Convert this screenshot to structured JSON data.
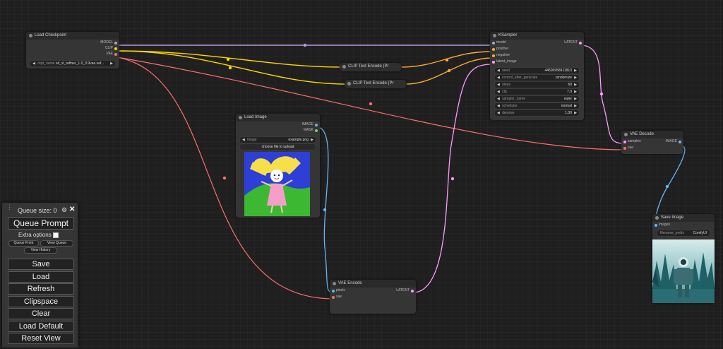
{
  "nodes": {
    "load_checkpoint": {
      "title": "Load Checkpoint",
      "outputs": [
        "MODEL",
        "CLIP",
        "VAE"
      ],
      "widget": {
        "label": "ckpt_name",
        "value": "sd_xl_refiner_1.0_0.9vae.saf..."
      }
    },
    "clip_text_encode_1": {
      "title": "CLIP Text Encode (Pr"
    },
    "clip_text_encode_2": {
      "title": "CLIP Text Encode (Pr"
    },
    "ksampler": {
      "title": "KSampler",
      "inputs": [
        "model",
        "positive",
        "negative",
        "latent_image"
      ],
      "output": "LATENT",
      "widgets": [
        {
          "label": "seed",
          "value": "44506958911810"
        },
        {
          "label": "control_after_generate",
          "value": "randomize"
        },
        {
          "label": "steps",
          "value": "60"
        },
        {
          "label": "cfg",
          "value": "7.0"
        },
        {
          "label": "sampler_name",
          "value": "euler"
        },
        {
          "label": "scheduler",
          "value": "normal"
        },
        {
          "label": "denoise",
          "value": "1.00"
        }
      ]
    },
    "load_image": {
      "title": "Load Image",
      "outputs": [
        "IMAGE",
        "MASK"
      ],
      "widget": {
        "label": "image",
        "value": "example.png"
      },
      "upload_button": "choose file to upload"
    },
    "vae_decode": {
      "title": "VAE Decode",
      "inputs": [
        "samples",
        "vae"
      ],
      "output": "IMAGE"
    },
    "save_image": {
      "title": "Save Image",
      "input": "images",
      "widget": {
        "label": "filename_prefix",
        "value": "ComfyUI"
      }
    },
    "vae_encode": {
      "title": "VAE Encode",
      "inputs": [
        "pixels",
        "vae"
      ],
      "output": "LATENT"
    }
  },
  "queue_panel": {
    "queue_size": "Queue size: 0",
    "queue_prompt": "Queue Prompt",
    "extra_options": "Extra options",
    "queue_front": "Queue Front",
    "view_queue": "View Queue",
    "view_history": "View History",
    "save": "Save",
    "load": "Load",
    "refresh": "Refresh",
    "clipspace": "Clipspace",
    "clear": "Clear",
    "load_default": "Load Default",
    "reset_view": "Reset View"
  },
  "colors": {
    "model": "#b39ddb",
    "clip": "#ffd500",
    "conditioning": "#ffa931",
    "vae": "#ff6e6e",
    "latent": "#ff9cf9",
    "image": "#64b5f6",
    "mask": "#81c784"
  }
}
